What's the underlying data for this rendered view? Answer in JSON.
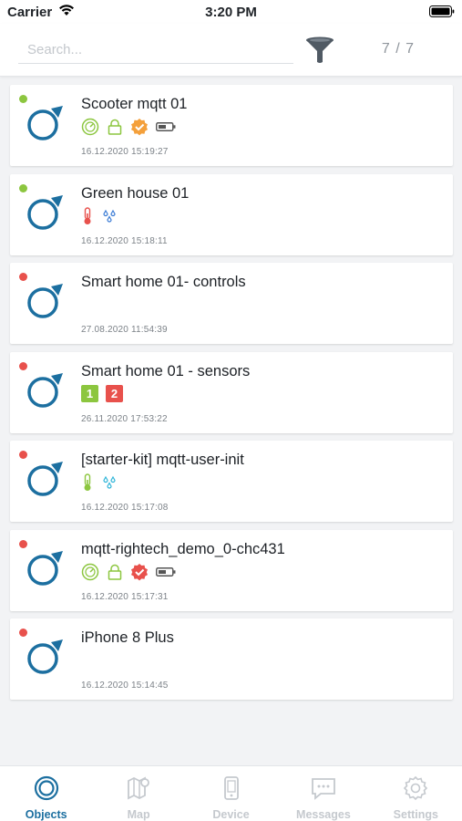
{
  "status_bar": {
    "carrier": "Carrier",
    "time": "3:20 PM"
  },
  "toolbar": {
    "search_placeholder": "Search...",
    "count": "7 / 7"
  },
  "colors": {
    "online": "#8cc63f",
    "offline": "#e8514c",
    "accent": "#1c6fa0",
    "green_icon": "#8cc63f",
    "orange_badge": "#f4a03b",
    "red_badge": "#e8514c"
  },
  "objects": [
    {
      "name": "Scooter mqtt 01",
      "status": "online",
      "icons": [
        "speedometer-icon",
        "lock-icon",
        "check-badge-orange-icon",
        "battery-icon"
      ],
      "timestamp": "16.12.2020 15:19:27"
    },
    {
      "name": "Green house 01",
      "status": "online",
      "icons": [
        "thermometer-red-icon",
        "drops-blue-icon"
      ],
      "timestamp": "16.12.2020 15:18:11"
    },
    {
      "name": "Smart home 01- controls",
      "status": "offline",
      "icons": [],
      "timestamp": "27.08.2020 11:54:39"
    },
    {
      "name": "Smart home 01 - sensors",
      "status": "offline",
      "icons": [
        "badge-1-green-icon",
        "badge-2-red-icon"
      ],
      "badge_labels": [
        "1",
        "2"
      ],
      "timestamp": "26.11.2020 17:53:22"
    },
    {
      "name": "[starter-kit] mqtt-user-init",
      "status": "offline",
      "icons": [
        "thermometer-green-icon",
        "drops-cyan-icon"
      ],
      "timestamp": "16.12.2020 15:17:08"
    },
    {
      "name": "mqtt-rightech_demo_0-chc431",
      "status": "offline",
      "icons": [
        "speedometer-icon",
        "lock-icon",
        "check-badge-red-icon",
        "battery-icon"
      ],
      "timestamp": "16.12.2020 15:17:31"
    },
    {
      "name": "iPhone 8 Plus",
      "status": "offline",
      "icons": [],
      "timestamp": "16.12.2020 15:14:45"
    }
  ],
  "tabs": [
    {
      "label": "Objects",
      "icon": "objects-icon",
      "active": true
    },
    {
      "label": "Map",
      "icon": "map-icon",
      "active": false
    },
    {
      "label": "Device",
      "icon": "device-icon",
      "active": false
    },
    {
      "label": "Messages",
      "icon": "messages-icon",
      "active": false
    },
    {
      "label": "Settings",
      "icon": "settings-icon",
      "active": false
    }
  ]
}
